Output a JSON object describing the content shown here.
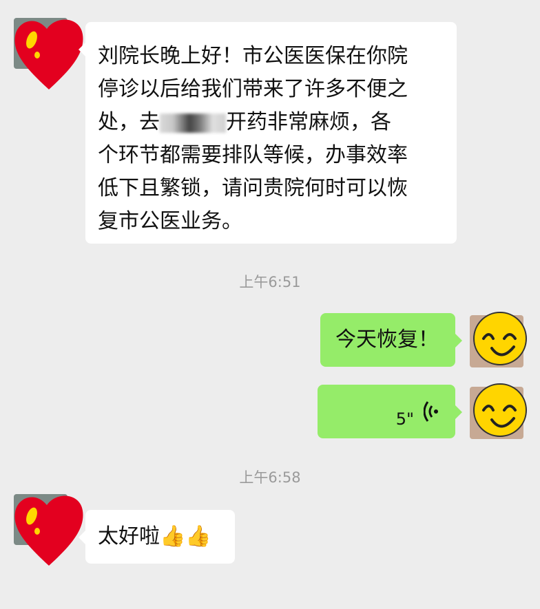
{
  "messages": [
    {
      "side": "left",
      "lines": [
        "刘院长晚上好！市公医医保在你院",
        "停诊以后给我们带来了许多不便之",
        "处，去",
        "开药非常麻烦，各",
        "个环节都需要排队等候，办事效率",
        "低下且繁锁，请问贵院何时可以恢",
        "复市公医业务。"
      ]
    },
    {
      "type": "timestamp",
      "text": "上午6:51"
    },
    {
      "side": "right",
      "text": "今天恢复！"
    },
    {
      "side": "right",
      "type": "voice",
      "duration": "5\""
    },
    {
      "type": "timestamp",
      "text": "上午6:58"
    },
    {
      "side": "left",
      "text": "太好啦",
      "emoji": "👍👍"
    }
  ],
  "colors": {
    "background": "#ededed",
    "left_bubble": "#ffffff",
    "right_bubble": "#95ec69",
    "timestamp": "#9a9a9a"
  },
  "icons": [
    "heart-avatar-icon",
    "smiley-avatar-icon",
    "voice-wave-icon",
    "thumbs-up-icon"
  ]
}
